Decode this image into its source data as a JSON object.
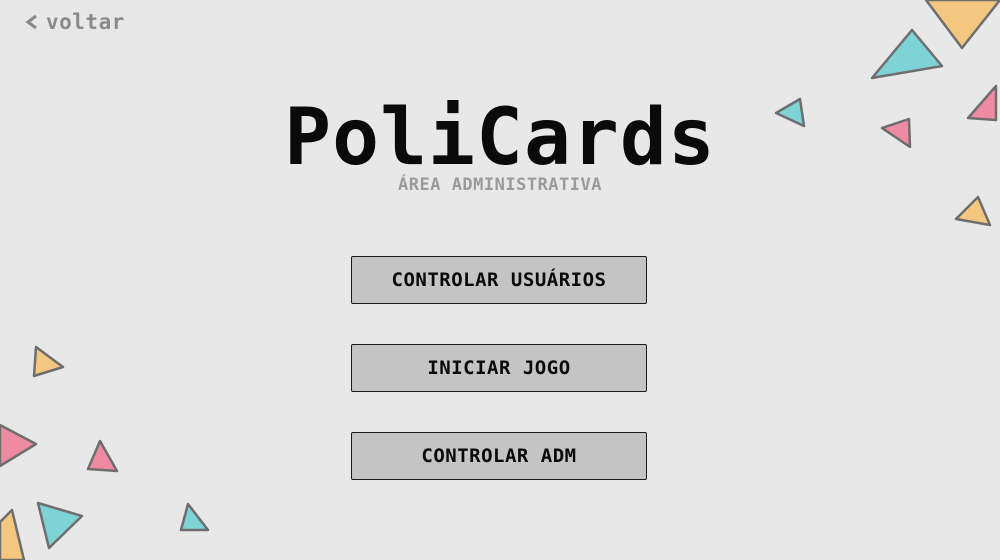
{
  "back": {
    "label": "voltar",
    "icon": "chevron-left-icon"
  },
  "header": {
    "title": "PoliCards",
    "subtitle": "ÁREA ADMINISTRATIVA"
  },
  "menu": {
    "buttons": [
      {
        "label": "CONTROLAR USUÁRIOS"
      },
      {
        "label": "INICIAR JOGO"
      },
      {
        "label": "CONTROLAR ADM"
      }
    ]
  },
  "colors": {
    "background": "#e8e8e8",
    "button_fill": "#c4c4c4",
    "triangle_orange": "#f3c77f",
    "triangle_teal": "#7ed3d7",
    "triangle_pink": "#ef8aa3"
  }
}
